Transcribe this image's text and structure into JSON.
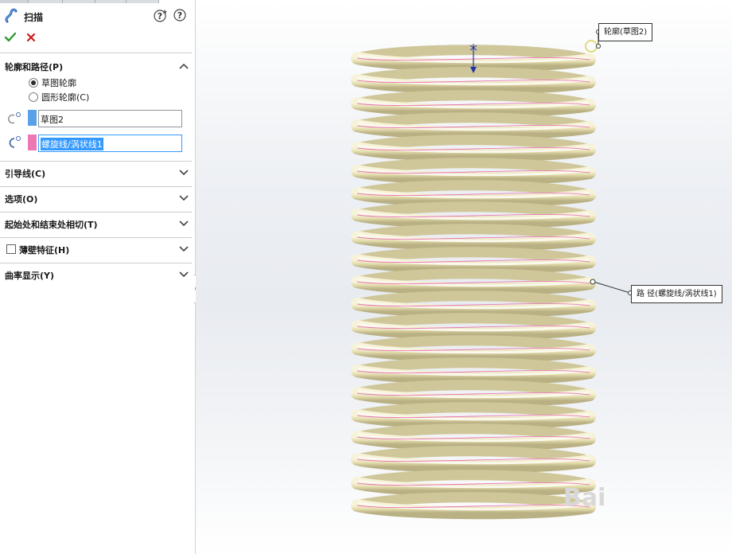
{
  "feature": {
    "title": "扫描",
    "icon": "sweep-icon"
  },
  "toolbar": {
    "ok_icon": "checkmark-icon",
    "cancel_icon": "cancel-x-icon",
    "help_icon": "help-icon"
  },
  "sections": {
    "profile_path": {
      "label": "轮廓和路径(P)",
      "options": [
        {
          "label": "草图轮廓",
          "selected": true
        },
        {
          "label": "圆形轮廓(C)",
          "selected": false
        }
      ],
      "profile_value": "草图2",
      "path_value": "螺旋线/涡状线1"
    },
    "guide_curves": {
      "label": "引导线(C)"
    },
    "options": {
      "label": "选项(O)"
    },
    "tangency": {
      "label": "起始处和结束处相切(T)"
    },
    "thin_feature": {
      "label": "薄壁特征(H)",
      "checked": false
    },
    "curvature": {
      "label": "曲率显示(Y)"
    }
  },
  "viewport": {
    "profile_callout": "轮廓(草图2)",
    "path_callout": "路 径(螺旋线/涡状线1)",
    "watermark": "Bai"
  },
  "colors": {
    "accent_blue": "#3399ff",
    "profile_swatch": "#5aa0e6",
    "path_swatch": "#ec78b4",
    "coil": "#e8e1b5",
    "ok_green": "#2f9a2f",
    "cancel_red": "#c81e1e"
  }
}
